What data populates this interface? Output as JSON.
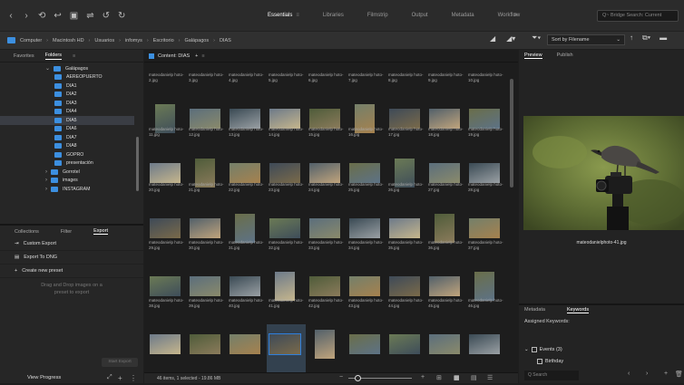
{
  "topbar": {
    "nav_icons": [
      "back-icon",
      "forward-icon",
      "recent-icon",
      "return-icon",
      "camera-icon",
      "refine-icon",
      "rotate-left-icon",
      "rotate-right-icon"
    ],
    "nav_glyphs": [
      "‹",
      "›",
      "⟲",
      "↩",
      "▣",
      "⇌",
      "↺",
      "↻"
    ],
    "workspaces": [
      {
        "label": "Essentials",
        "active": true,
        "menu": "≡"
      },
      {
        "label": "Libraries",
        "active": false
      },
      {
        "label": "Filmstrip",
        "active": false
      },
      {
        "label": "Output",
        "active": false
      },
      {
        "label": "Metadata",
        "active": false
      },
      {
        "label": "Workflow",
        "active": false
      }
    ],
    "more": "»",
    "search_placeholder": "Q~ Bridge Search: Current"
  },
  "path": {
    "crumbs": [
      "Computer",
      "Macintosh HD",
      "Usuarios",
      "infomys",
      "Escritorio",
      "Galápagos",
      "DIAS"
    ],
    "sort_label": "Sort by Filename"
  },
  "folders_panel": {
    "tabs": [
      {
        "label": "Favorites",
        "active": false
      },
      {
        "label": "Folders",
        "active": true
      }
    ],
    "items": [
      {
        "label": "Galápagos",
        "depth": 1,
        "expanded": true
      },
      {
        "label": "AEREOPUERTO",
        "depth": 2
      },
      {
        "label": "DIA1",
        "depth": 2
      },
      {
        "label": "DIA2",
        "depth": 2
      },
      {
        "label": "DIA3",
        "depth": 2
      },
      {
        "label": "DIA4",
        "depth": 2
      },
      {
        "label": "DIA5",
        "depth": 2,
        "selected": true
      },
      {
        "label": "DIA6",
        "depth": 2
      },
      {
        "label": "DIA7",
        "depth": 2
      },
      {
        "label": "DIA8",
        "depth": 2
      },
      {
        "label": "GOPRO",
        "depth": 2
      },
      {
        "label": "presentación",
        "depth": 2
      },
      {
        "label": "Gorrotel",
        "depth": 1,
        "collapsed": true
      },
      {
        "label": "images",
        "depth": 1
      },
      {
        "label": "INSTAGRAM",
        "depth": 1,
        "collapsed": true
      }
    ]
  },
  "export_panel": {
    "tabs": [
      {
        "label": "Collections",
        "active": false
      },
      {
        "label": "Filter",
        "active": false
      },
      {
        "label": "Export",
        "active": true
      }
    ],
    "items": [
      {
        "label": "Custom Export",
        "icon": "export-icon"
      },
      {
        "label": "Export To DNG",
        "icon": "dng-icon"
      },
      {
        "label": "Create new preset",
        "icon": "plus-icon"
      }
    ],
    "drop_text": "Drag and Drop images on a preset to export",
    "start_export": "Start Export",
    "view_progress": "View Progress"
  },
  "content": {
    "title": "Content: DIAS",
    "status": "46 items, 1 selected - 19.86 MB",
    "rows": [
      [
        "mateodanielp hoto-2.jpg",
        "mateodanielp hoto-3.jpg",
        "mateodanielp hoto-4.jpg",
        "mateodanielp hoto-5.jpg",
        "mateodanielp hoto-6.jpg",
        "mateodanielp hoto-7.jpg",
        "mateodanielp hoto-8.jpg",
        "mateodanielp hoto-9.jpg",
        "mateodanielp hoto-10.jpg"
      ],
      [
        "mateodanielp hoto-11.jpg",
        "mateodanielp hoto-12.jpg",
        "mateodanielp hoto-13.jpg",
        "mateodanielp hoto-14.jpg",
        "mateodanielp hoto-15.jpg",
        "mateodanielp hoto-16.jpg",
        "mateodanielp hoto-17.jpg",
        "mateodanielp hoto-18.jpg",
        "mateodanielp hoto-19.jpg"
      ],
      [
        "mateodanielp hoto-20.jpg",
        "mateodanielp hoto-21.jpg",
        "mateodanielp hoto-22.jpg",
        "mateodanielp hoto-23.jpg",
        "mateodanielp hoto-24.jpg",
        "mateodanielp hoto-25.jpg",
        "mateodanielp hoto-26.jpg",
        "mateodanielp hoto-27.jpg",
        "mateodanielp hoto-28.jpg"
      ],
      [
        "mateodanielp hoto-29.jpg",
        "mateodanielp hoto-30.jpg",
        "mateodanielp hoto-31.jpg",
        "mateodanielp hoto-32.jpg",
        "mateodanielp hoto-33.jpg",
        "mateodanielp hoto-34.jpg",
        "mateodanielp hoto-35.jpg",
        "mateodanielp hoto-36.jpg",
        "mateodanielp hoto-37.jpg"
      ],
      [
        "mateodanielp hoto-38.jpg",
        "mateodanielp hoto-39.jpg",
        "mateodanielp hoto-40.jpg",
        "mateodanielp hoto-41.jpg",
        "mateodanielp hoto-42.jpg",
        "mateodanielp hoto-43.jpg",
        "mateodanielp hoto-44.jpg",
        "mateodanielp hoto-45.jpg",
        "mateodanielp hoto-46.jpg"
      ]
    ],
    "selected": "mateodanielp hoto-41.jpg"
  },
  "preview_panel": {
    "tabs": [
      {
        "label": "Preview",
        "active": true
      },
      {
        "label": "Publish",
        "active": false
      }
    ],
    "filename": "mateodanielphoto-41.jpg"
  },
  "meta_panel": {
    "tabs": [
      {
        "label": "Metadata",
        "active": false
      },
      {
        "label": "Keywords",
        "active": true
      }
    ],
    "assigned_label": "Assigned Keywords:",
    "keywords": [
      "Events (3)",
      "Birthday"
    ],
    "search_placeholder": "Q Search"
  },
  "colors": {
    "accent": "#3c8fe0",
    "panel": "#262626",
    "selection": "#2f7fdc"
  }
}
